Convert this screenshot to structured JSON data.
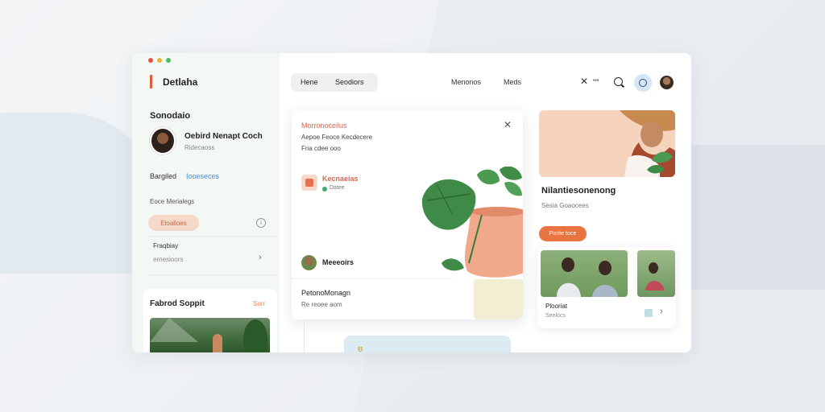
{
  "window": {
    "dot_colors": [
      "#e5533d",
      "#f0b23a",
      "#4cbb5a"
    ]
  },
  "sidebar": {
    "logo": "Detlaha",
    "section_title": "Sonodaio",
    "profile": {
      "name": "Oebird Nenapt Coch",
      "sub": "Ridecaoss"
    },
    "row1": {
      "left": "Bargiled",
      "right": "Iooeseces"
    },
    "row2": "Eoce Merialegs",
    "pill_label": "Eloalloes",
    "info_icon": "i",
    "row3": {
      "title": "Fraqbiay",
      "sub": "ernesioors"
    },
    "chevron": "›",
    "featured": {
      "title": "Fabrod Soppit",
      "link": "Sorr"
    }
  },
  "header": {
    "tabs": [
      "Hene",
      "Seodiors"
    ],
    "nav": [
      "Menonos",
      "Meds"
    ],
    "x_label": "✕",
    "x_dots": "•••"
  },
  "dialog": {
    "title": "Morronoceilus",
    "sub1": "Aepoe Feoce Kecdecere",
    "sub2": "Fna cdee ooo",
    "close": "✕",
    "feature_title": "Kecnaeias",
    "status": "Datee",
    "person": "Meeeoirs",
    "footer_title": "PetonoMonagn",
    "footer_sub": "Re reoee aom"
  },
  "right": {
    "title": "Nilantiesonenong",
    "sub": "Sesia Goaocees",
    "cta": "Porite toce",
    "photo_title": "Plooriat",
    "photo_sub": "Seelocs",
    "chevron": "›"
  },
  "blob_glyph": "ᵿ"
}
